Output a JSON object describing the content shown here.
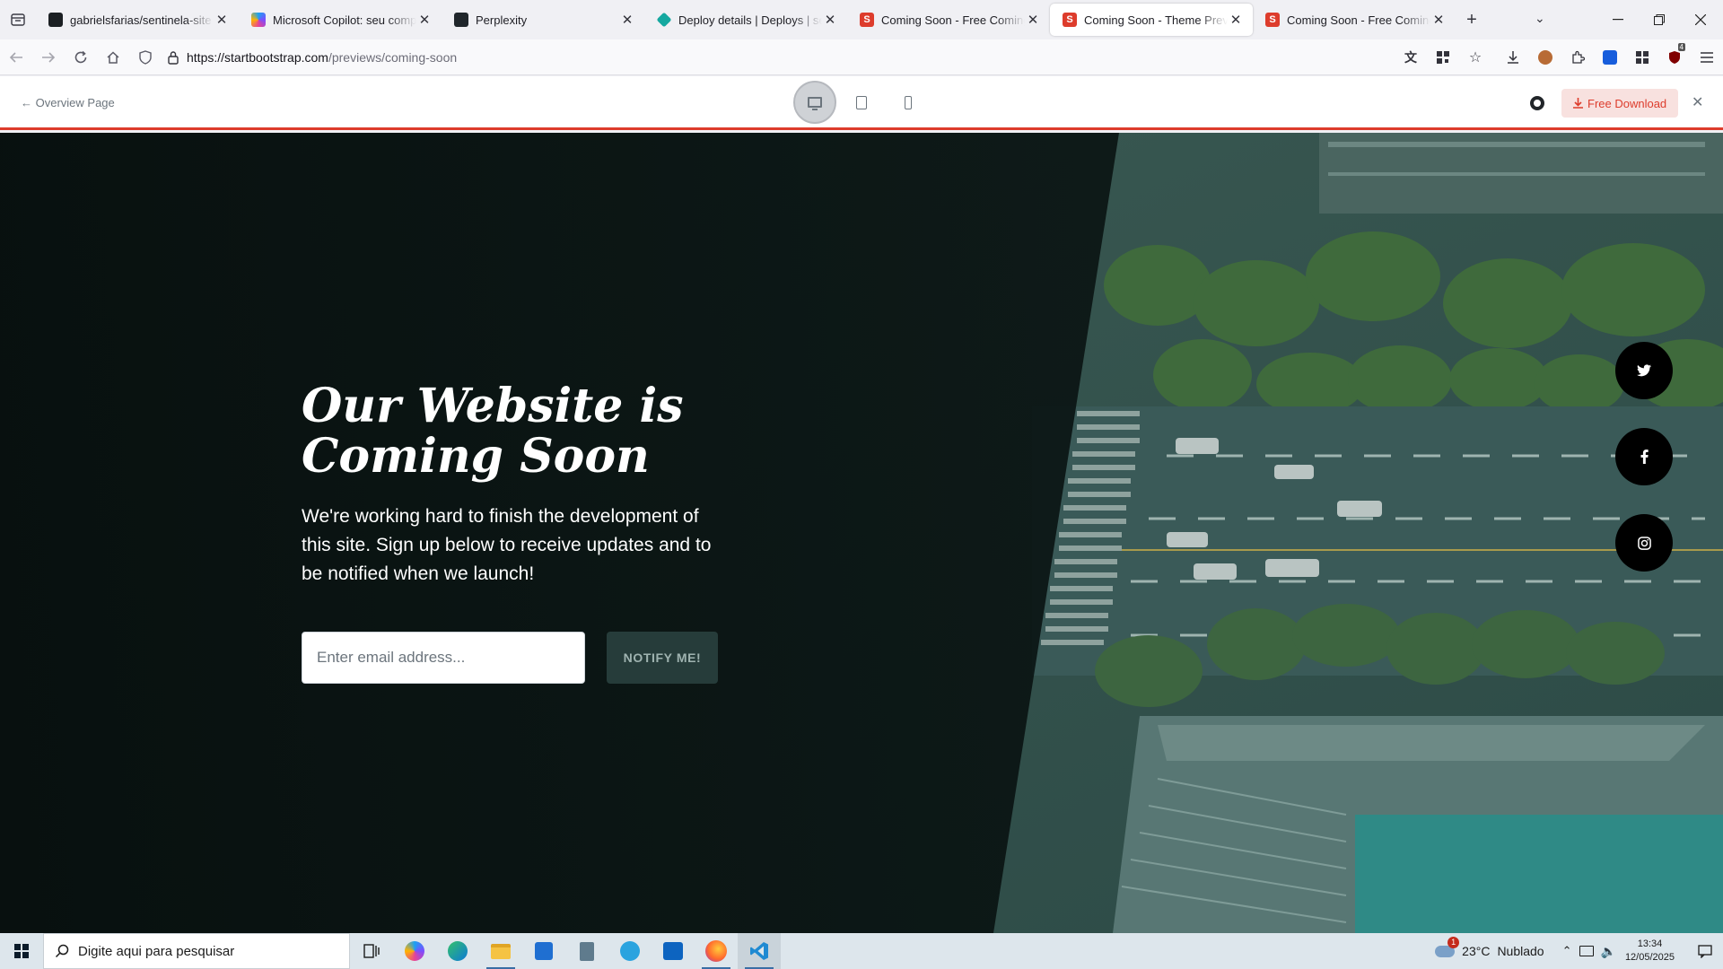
{
  "browser": {
    "tabs": [
      {
        "title": "gabrielsfarias/sentinela-site",
        "favicon": "github-icon",
        "active": false
      },
      {
        "title": "Microsoft Copilot: seu compan",
        "favicon": "copilot-icon",
        "active": false
      },
      {
        "title": "Perplexity",
        "favicon": "perplexity-icon",
        "active": false
      },
      {
        "title": "Deploy details | Deploys | sentin",
        "favicon": "netlify-icon",
        "active": false
      },
      {
        "title": "Coming Soon - Free Coming So",
        "favicon": "startbootstrap-icon",
        "active": false
      },
      {
        "title": "Coming Soon - Theme Preview",
        "favicon": "startbootstrap-icon",
        "active": true
      },
      {
        "title": "Coming Soon - Free Coming So",
        "favicon": "startbootstrap-icon",
        "active": false
      }
    ],
    "favicon_letter": "S",
    "new_tab_label": "+",
    "url_host": "https://startbootstrap.com",
    "url_path": "/previews/coming-soon",
    "extension_badge": "4"
  },
  "preview_bar": {
    "back_label": "← Overview Page",
    "download_label": "Free Download",
    "devices": [
      "desktop",
      "tablet",
      "mobile"
    ],
    "active_device": "desktop",
    "accent": "#dd3c2c"
  },
  "hero": {
    "headline_line1": "Our Website is",
    "headline_line2": "Coming Soon",
    "subtext": "We're working hard to finish the development of this site. Sign up below to receive updates and to be notified when we launch!",
    "email_placeholder": "Enter email address...",
    "notify_label": "NOTIFY ME!",
    "social": [
      "twitter-icon",
      "facebook-icon",
      "instagram-icon"
    ]
  },
  "taskbar": {
    "search_placeholder": "Digite aqui para pesquisar",
    "weather_temp": "23°C",
    "weather_text": "Nublado",
    "weather_badge": "1",
    "time": "13:34",
    "date": "12/05/2025"
  }
}
